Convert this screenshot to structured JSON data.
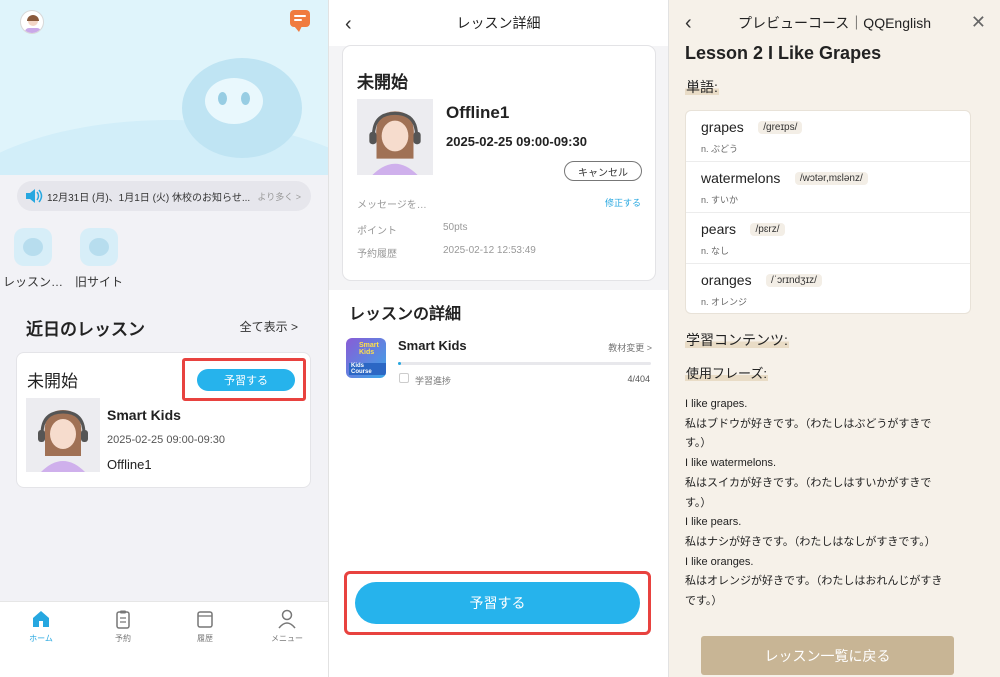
{
  "home": {
    "notice_text": "12月31日 (月)、1月1日 (火) 休校のお知らせ...",
    "notice_more": "より多く >",
    "shortcuts": [
      {
        "label": "レッスン…"
      },
      {
        "label": "旧サイト"
      }
    ],
    "recent_title": "近日のレッスン",
    "see_all": "全て表示 >",
    "card": {
      "status": "未開始",
      "prepare_btn": "予習する",
      "course": "Smart Kids",
      "time": "2025-02-25 09:00-09:30",
      "teacher": "Offline1"
    },
    "tabs": [
      {
        "label": "ホーム",
        "icon": "home-icon"
      },
      {
        "label": "予約",
        "icon": "clipboard-icon"
      },
      {
        "label": "履歴",
        "icon": "book-icon"
      },
      {
        "label": "メニュー",
        "icon": "person-icon"
      }
    ]
  },
  "detail": {
    "title": "レッスン詳細",
    "status": "未開始",
    "teacher": "Offline1",
    "time": "2025-02-25 09:00-09:30",
    "cancel_btn": "キャンセル",
    "message_label": "メッセージを…",
    "edit": "修正する",
    "points_label": "ポイント",
    "points_value": "50pts",
    "booked_label": "予約履歴",
    "booked_value": "2025-02-12 12:53:49",
    "section_title": "レッスンの詳細",
    "course_name": "Smart Kids",
    "course_thumb_top": "Smart Kids",
    "course_thumb_bottom": "Kids Course",
    "change_material": "教材変更 >",
    "progress_label": "学習進捗",
    "progress_text": "4/404",
    "progress_fraction": 0.0099,
    "prepare_btn": "予習する"
  },
  "preview": {
    "title": "プレビューコース｜QQEnglish",
    "lesson_title": "Lesson 2 I Like Grapes",
    "vocab_heading": "単語:",
    "vocab": [
      {
        "word": "grapes",
        "phonetic": "/greɪps/",
        "meaning": "n. ぶどう"
      },
      {
        "word": "watermelons",
        "phonetic": "/wɔtər,mɛlənz/",
        "meaning": "n. すいか"
      },
      {
        "word": "pears",
        "phonetic": "/pɛrz/",
        "meaning": "n. なし"
      },
      {
        "word": "oranges",
        "phonetic": "/ˈɔrɪndʒɪz/",
        "meaning": "n. オレンジ"
      }
    ],
    "content_heading": "学習コンテンツ:",
    "phrases_heading": "使用フレーズ:",
    "sample_lines": [
      "I like grapes.",
      "私はブドウが好きです。（わたしはぶどうがすきで",
      "す。）",
      "I like watermelons.",
      "私はスイカが好きです。（わたしはすいかがすきで",
      "す。）",
      "I like pears.",
      "私はナシが好きです。（わたしはなしがすきです。）",
      "I like oranges.",
      "私はオレンジが好きです。（わたしはおれんじがすき",
      "です。）"
    ],
    "back_btn": "レッスン一覧に戻る"
  },
  "colors": {
    "accent": "#26b3ec",
    "highlight": "#e8423f",
    "beige_button": "#c8b595",
    "chat": "#f07b3f"
  }
}
